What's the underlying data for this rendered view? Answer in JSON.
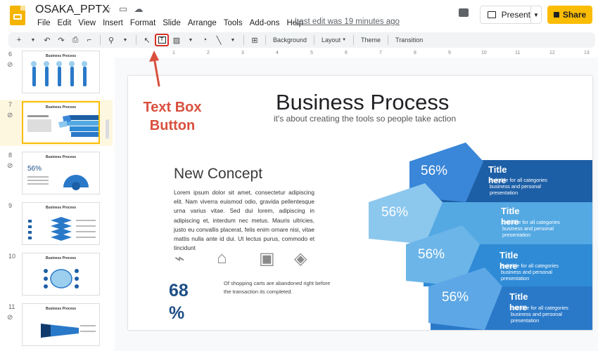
{
  "header": {
    "doc_title": "OSAKA_PPTX",
    "menus": [
      "File",
      "Edit",
      "View",
      "Insert",
      "Format",
      "Slide",
      "Arrange",
      "Tools",
      "Add-ons",
      "Help"
    ],
    "last_edit": "Last edit was 19 minutes ago",
    "present_label": "Present",
    "share_label": "Share"
  },
  "toolbar": {
    "background_label": "Background",
    "layout_label": "Layout",
    "theme_label": "Theme",
    "transition_label": "Transition"
  },
  "ruler": {
    "numbers": [
      "1",
      "2",
      "3",
      "4",
      "5",
      "6",
      "7",
      "8",
      "9",
      "10",
      "11",
      "12",
      "13"
    ]
  },
  "filmstrip": {
    "slides": [
      {
        "num": "6",
        "title": "Business Process",
        "selected": false
      },
      {
        "num": "7",
        "title": "Business Process",
        "selected": true
      },
      {
        "num": "8",
        "title": "Business Process",
        "selected": false,
        "big_text": "56%"
      },
      {
        "num": "9",
        "title": "Business Process",
        "selected": false
      },
      {
        "num": "10",
        "title": "Business Process",
        "selected": false
      },
      {
        "num": "11",
        "title": "Business Process",
        "selected": false
      }
    ]
  },
  "slide": {
    "title": "Business Process",
    "subtitle": "it's about creating the tools so people take action",
    "concept_title": "New Concept",
    "concept_body": "Lorem ipsum dolor sit amet, consectetur adipiscing elit. Nam viverra euismod odio, gravida pellentesque urna varius vitae. Sed dui lorem, adipiscing in adipiscing et, interdum nec metus. Mauris ultricies, justo eu convallis placerat, felis enim ornare nisi, vitae mattis nulla ante id dui. Ut lectus purus, commodo et tincidunt",
    "stat_number": "68",
    "stat_unit": "%",
    "stat_caption": "Of shopping carts are abandoned right before the transaction its completed.",
    "bands": [
      {
        "pct": "56%",
        "title": "Title",
        "here": "here",
        "desc": "Suitable for all categories business and personal presentation",
        "color": "#1d5fa6",
        "chev": "#3a86d8"
      },
      {
        "pct": "56%",
        "title": "Title",
        "here": "here",
        "desc": "Suitable for all categories business and personal presentation",
        "color": "#54a9e3",
        "chev": "#8cc7ee"
      },
      {
        "pct": "56%",
        "title": "Title",
        "here": "here",
        "desc": "Suitable for all categories business and personal presentation",
        "color": "#2f8bd6",
        "chev": "#6cb5e8"
      },
      {
        "pct": "56%",
        "title": "Title",
        "here": "here",
        "desc": "Suitable for all categories business and personal presentation",
        "color": "#2a79c9",
        "chev": "#5da7e6"
      }
    ]
  },
  "annotation": {
    "label_line1": "Text Box",
    "label_line2": "Button",
    "color": "#d94f3d"
  }
}
